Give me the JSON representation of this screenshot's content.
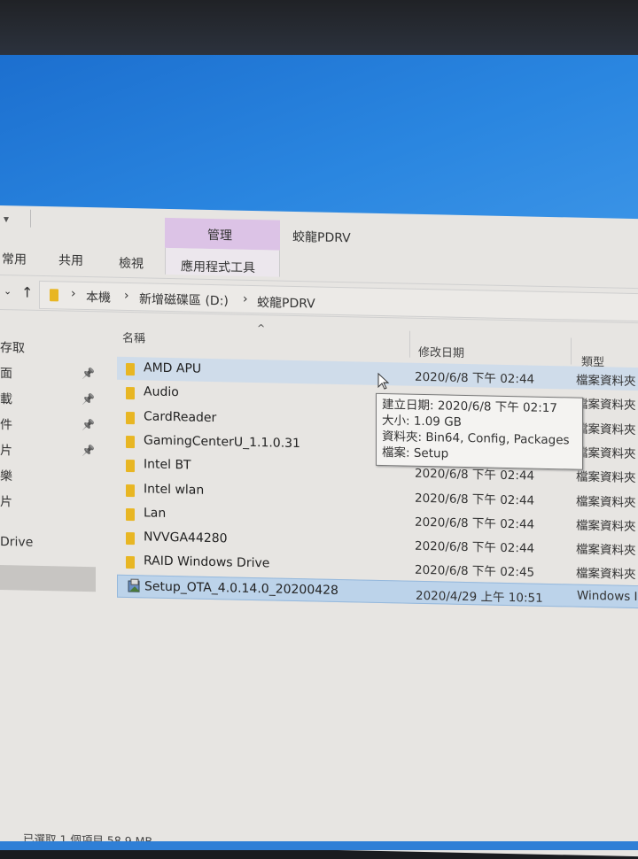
{
  "ribbon": {
    "contextual_group": "管理",
    "window_title": "蛟龍PDRV",
    "tabs": [
      "常用",
      "共用",
      "檢視",
      "應用程式工具"
    ]
  },
  "address": {
    "crumbs": [
      "本機",
      "新增磁碟區 (D:)",
      "蛟龍PDRV"
    ]
  },
  "columns": {
    "name": "名稱",
    "date": "修改日期",
    "type": "類型"
  },
  "sidebar": {
    "items": [
      {
        "label": "存取",
        "pinned": false
      },
      {
        "label": "面",
        "pinned": true
      },
      {
        "label": "載",
        "pinned": true
      },
      {
        "label": "件",
        "pinned": true
      },
      {
        "label": "片",
        "pinned": true
      },
      {
        "label": "樂",
        "pinned": false
      },
      {
        "label": "片",
        "pinned": false
      },
      {
        "label": "Drive",
        "pinned": false
      }
    ]
  },
  "files": [
    {
      "name": "AMD APU",
      "date": "2020/6/8 下午 02:44",
      "type": "檔案資料夾",
      "icon": "folder-icon",
      "state": "hover"
    },
    {
      "name": "Audio",
      "date": "",
      "type": "檔案資料夾",
      "icon": "folder-icon"
    },
    {
      "name": "CardReader",
      "date": "",
      "type": "檔案資料夾",
      "icon": "folder-icon"
    },
    {
      "name": "GamingCenterU_1.1.0.31",
      "date": "",
      "type": "檔案資料夾",
      "icon": "folder-icon"
    },
    {
      "name": "Intel BT",
      "date": "2020/6/8 下午 02:44",
      "type": "檔案資料夾",
      "icon": "folder-icon"
    },
    {
      "name": "Intel wlan",
      "date": "2020/6/8 下午 02:44",
      "type": "檔案資料夾",
      "icon": "folder-icon"
    },
    {
      "name": "Lan",
      "date": "2020/6/8 下午 02:44",
      "type": "檔案資料夾",
      "icon": "folder-icon"
    },
    {
      "name": "NVVGA44280",
      "date": "2020/6/8 下午 02:44",
      "type": "檔案資料夾",
      "icon": "folder-icon"
    },
    {
      "name": "RAID Windows Drive",
      "date": "2020/6/8 下午 02:45",
      "type": "檔案資料夾",
      "icon": "folder-icon"
    },
    {
      "name": "Setup_OTA_4.0.14.0_20200428",
      "date": "2020/4/29 上午 10:51",
      "type": "Windows In",
      "icon": "installer-icon",
      "state": "selected"
    }
  ],
  "tooltip": {
    "created": "建立日期: 2020/6/8 下午 02:17",
    "size": "大小: 1.09 GB",
    "folders": "資料夾: Bin64, Config, Packages",
    "files": "檔案: Setup"
  },
  "status": {
    "text": "已選取 1 個項目  58.9 MB"
  },
  "colors": {
    "context_tab": "#dcc3e6",
    "selection": "#bcd3ea",
    "folder": "#e8b623",
    "desktop": "#2a86e0"
  }
}
